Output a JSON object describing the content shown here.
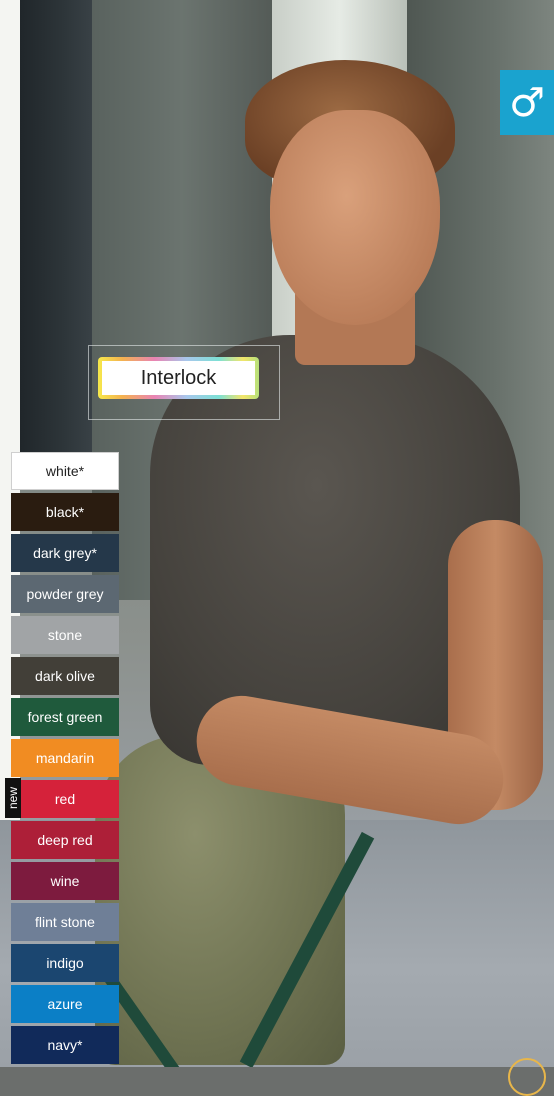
{
  "gender_icon": "male-symbol-icon",
  "gender_symbol": "♂",
  "fabric": {
    "label": "Interlock"
  },
  "new_tag": "new",
  "colors": [
    {
      "label": "white*",
      "bg": "#ffffff",
      "fg": "#222222"
    },
    {
      "label": "black*",
      "bg": "#2a1c10",
      "fg": "#ffffff"
    },
    {
      "label": "dark grey*",
      "bg": "#25384a",
      "fg": "#ffffff"
    },
    {
      "label": "powder grey",
      "bg": "#5c6872",
      "fg": "#ffffff"
    },
    {
      "label": "stone",
      "bg": "#a1a4a6",
      "fg": "#ffffff"
    },
    {
      "label": "dark olive",
      "bg": "#423f38",
      "fg": "#ffffff"
    },
    {
      "label": "forest green",
      "bg": "#1f5a3c",
      "fg": "#ffffff"
    },
    {
      "label": "mandarin",
      "bg": "#f18c22",
      "fg": "#ffffff"
    },
    {
      "label": "red",
      "bg": "#d5223a",
      "fg": "#ffffff"
    },
    {
      "label": "deep red",
      "bg": "#ad1f38",
      "fg": "#ffffff"
    },
    {
      "label": "wine",
      "bg": "#7d1b3e",
      "fg": "#ffffff"
    },
    {
      "label": "flint stone",
      "bg": "#6f7f97",
      "fg": "#ffffff"
    },
    {
      "label": "indigo",
      "bg": "#1b4670",
      "fg": "#ffffff"
    },
    {
      "label": "azure",
      "bg": "#0b7fc6",
      "fg": "#ffffff"
    },
    {
      "label": "navy*",
      "bg": "#112a5a",
      "fg": "#ffffff"
    }
  ]
}
